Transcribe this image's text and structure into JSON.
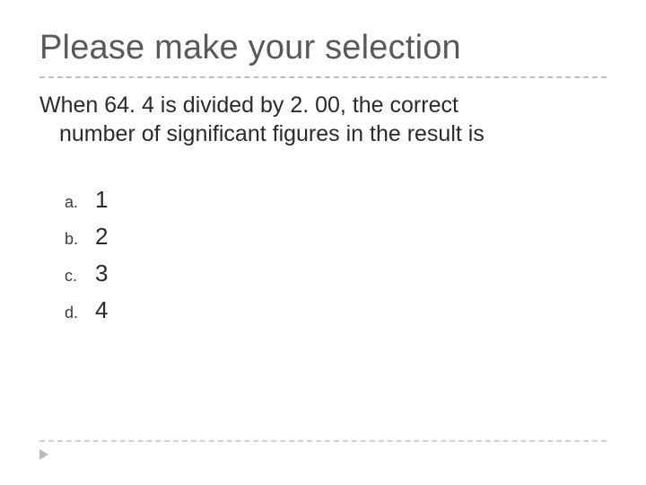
{
  "title": "Please make your selection",
  "question": {
    "line1": "When 64. 4 is divided by 2. 00, the correct",
    "line2": "number of significant figures in the result is"
  },
  "options": [
    {
      "letter": "a.",
      "value": "1"
    },
    {
      "letter": "b.",
      "value": "2"
    },
    {
      "letter": "c.",
      "value": "3"
    },
    {
      "letter": "d.",
      "value": "4"
    }
  ]
}
